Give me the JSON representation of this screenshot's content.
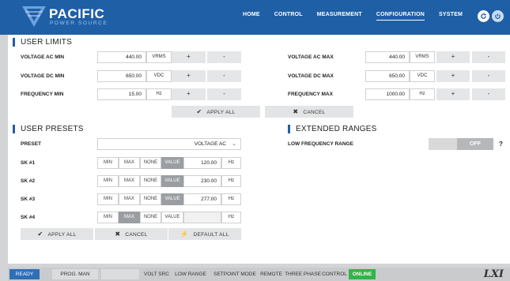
{
  "brand": {
    "name": "PACIFIC",
    "sub": "POWER SOURCE"
  },
  "nav": [
    "HOME",
    "CONTROL",
    "MEASUREMENT",
    "CONFIGURATION",
    "SYSTEM"
  ],
  "nav_active": "CONFIGURATION",
  "user_limits": {
    "title": "USER LIMITS",
    "rows": [
      {
        "label": "VOLTAGE AC MIN",
        "value": "440.00",
        "unit": "VRMS"
      },
      {
        "label": "VOLTAGE DC MIN",
        "value": "650.00",
        "unit": "VDC"
      },
      {
        "label": "FREQUENCY MIN",
        "value": "15.00",
        "unit": "Hz"
      },
      {
        "label": "VOLTAGE AC MAX",
        "value": "440.00",
        "unit": "VRMS"
      },
      {
        "label": "VOLTAGE DC MAX",
        "value": "650.00",
        "unit": "VDC"
      },
      {
        "label": "FREQUENCY MAX",
        "value": "1000.00",
        "unit": "Hz"
      }
    ],
    "plus": "+",
    "minus": "-",
    "apply": "APPLY ALL",
    "cancel": "CANCEL"
  },
  "user_presets": {
    "title": "USER PRESETS",
    "preset_label": "PRESET",
    "preset_value": "VOLTAGE AC",
    "seg_labels": [
      "MIN",
      "MAX",
      "NONE",
      "VALUE"
    ],
    "rows": [
      {
        "label": "SK #1",
        "value": "120.00",
        "unit": "Hz",
        "selected": "VALUE"
      },
      {
        "label": "SK #2",
        "value": "230.00",
        "unit": "Hz",
        "selected": "VALUE"
      },
      {
        "label": "SK #3",
        "value": "277.00",
        "unit": "Hz",
        "selected": "VALUE"
      },
      {
        "label": "SK #4",
        "value": "",
        "unit": "Hz",
        "selected": "MAX"
      }
    ],
    "apply": "APPLY ALL",
    "cancel": "CANCEL",
    "default": "DEFAULT ALL"
  },
  "extended_ranges": {
    "title": "EXTENDED RANGES",
    "label": "LOW FREQUENCY RANGE",
    "toggle": "OFF",
    "help": "?"
  },
  "status": {
    "ready": "READY",
    "prog": "PROG. MAN",
    "items": [
      "VOLT SRC",
      "LOW RANGE",
      "SETPOINT MODE",
      "REMOTE",
      "THREE PHASE",
      "CONTROL"
    ],
    "online": "ONLINE",
    "logo": "LXI"
  },
  "colors": {
    "brand_blue": "#1f5fa6",
    "online_green": "#34b34a",
    "ready_blue": "#2f6fb8"
  }
}
